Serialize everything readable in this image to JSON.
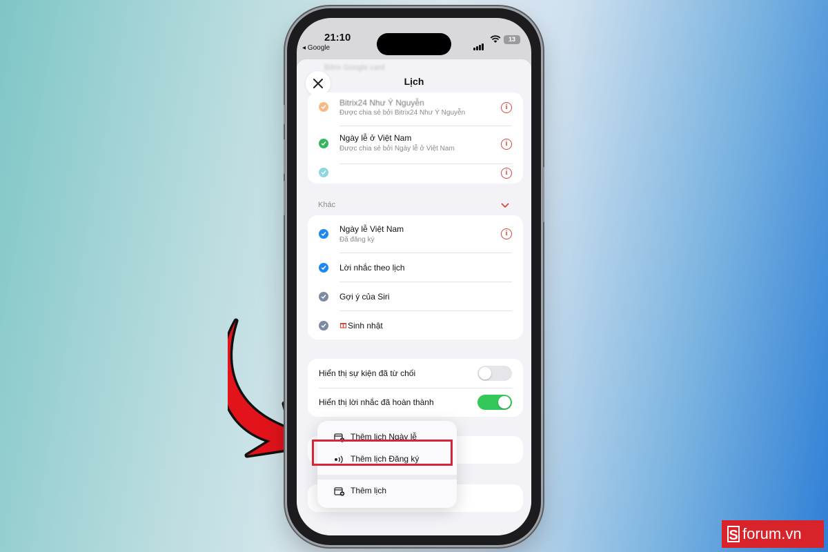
{
  "status_bar": {
    "time": "21:10",
    "back_app": "◂ Google",
    "battery": "13"
  },
  "sheet": {
    "ghost_text": "Bitrix Google card",
    "title": "Lịch"
  },
  "accounts_card": {
    "rows": [
      {
        "title": "Bitrix24 Như Ý Nguyễn",
        "subtitle": "Được chia sẻ bởi Bitrix24 Như Ý Nguyễn",
        "check_color": "#f5a35c"
      },
      {
        "title": "Ngày lễ ở Việt Nam",
        "subtitle": "Được chia sẻ bởi Ngày lễ ở Việt Nam",
        "check_color": "#34b75a"
      },
      {
        "title": "",
        "subtitle": "",
        "check_color": "#8fd6de"
      }
    ],
    "info_symbol": "i"
  },
  "other_section": {
    "label": "Khác",
    "rows": [
      {
        "title": "Ngày lễ Việt Nam",
        "subtitle": "Đã đăng ký",
        "check_color": "#1e88f0"
      },
      {
        "title": "Lời nhắc theo lịch",
        "check_color": "#1e88f0"
      },
      {
        "title": "Gợi ý của Siri",
        "check_color": "#7d8aa3"
      },
      {
        "title": "Sinh nhật",
        "check_color": "#7d8aa3"
      }
    ]
  },
  "toggles": [
    {
      "label": "Hiển thị sự kiện đã từ chối",
      "on": false
    },
    {
      "label": "Hiển thị lời nhắc đã hoàn thành",
      "on": true,
      "on_color": "#34c759"
    }
  ],
  "context_menu": {
    "items": [
      {
        "label": "Thêm lịch Ngày lễ",
        "icon": "calendar-add-icon"
      },
      {
        "label": "Thêm lịch Đăng ký",
        "icon": "broadcast-icon"
      },
      {
        "label": "Thêm lịch",
        "icon": "calendar-add-icon"
      }
    ]
  },
  "annotation": {
    "highlight_color": "#d8243a",
    "arrow_color": "#e3131b"
  },
  "watermark": {
    "text": "forum.vn",
    "letter": "S"
  }
}
